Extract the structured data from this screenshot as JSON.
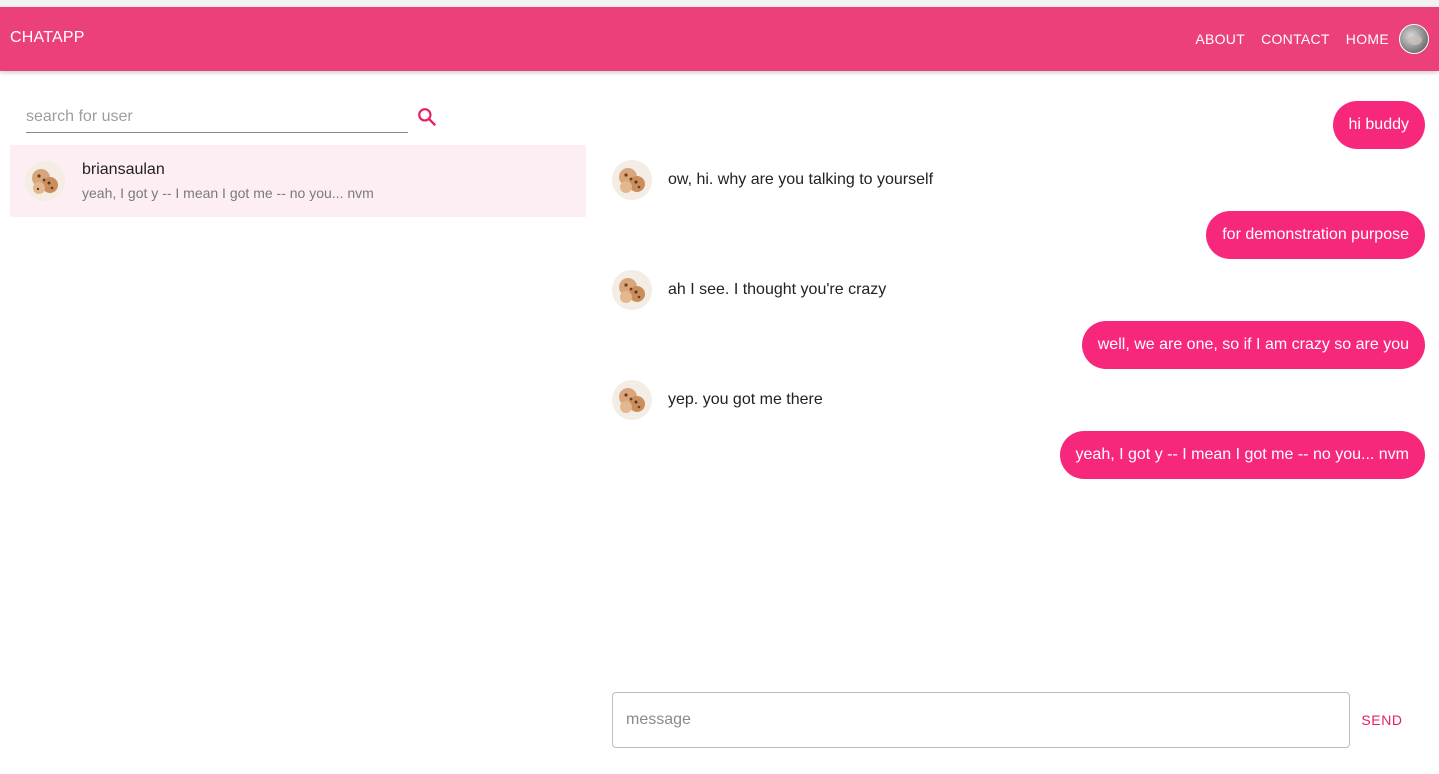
{
  "app": {
    "title": "CHATAPP",
    "nav": [
      "ABOUT",
      "CONTACT",
      "HOME"
    ],
    "accent_color": "#ec407a",
    "bubble_color": "#f7287b"
  },
  "sidebar": {
    "search_placeholder": "search for user",
    "search_icon": "search-icon",
    "contacts": [
      {
        "name": "briansaulan",
        "last_message": "yeah, I got y -- I mean I got me -- no you... nvm",
        "selected": true
      }
    ]
  },
  "chat": {
    "messages": [
      {
        "direction": "outgoing",
        "text": "hi buddy"
      },
      {
        "direction": "incoming",
        "text": "ow, hi. why are you talking to yourself"
      },
      {
        "direction": "outgoing",
        "text": "for demonstration purpose"
      },
      {
        "direction": "incoming",
        "text": "ah I see. I thought you're crazy"
      },
      {
        "direction": "outgoing",
        "text": "well, we are one, so if I am crazy so are you"
      },
      {
        "direction": "incoming",
        "text": "yep. you got me there"
      },
      {
        "direction": "outgoing",
        "text": "yeah, I got y -- I mean I got me -- no you... nvm"
      }
    ],
    "input_placeholder": "message",
    "send_label": "SEND"
  }
}
